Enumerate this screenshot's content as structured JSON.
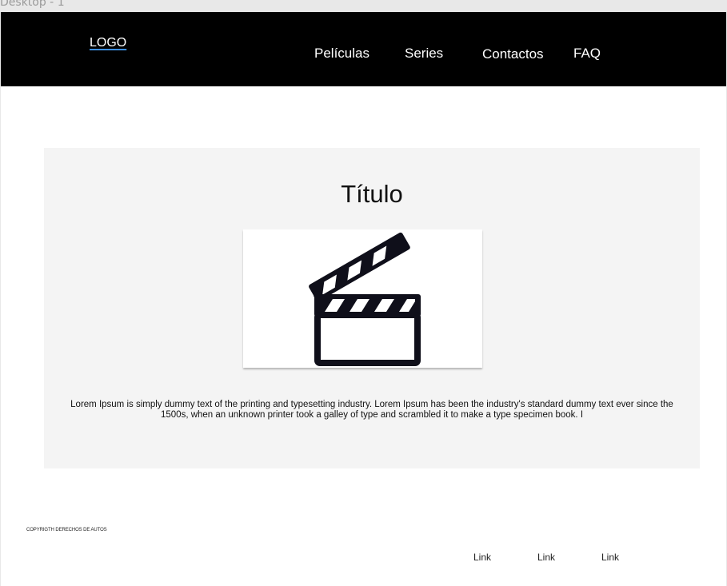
{
  "frame": {
    "label": "Desktop - 1"
  },
  "header": {
    "logo": "LOGO",
    "nav": [
      "Películas",
      "Series",
      "Contactos",
      "FAQ"
    ]
  },
  "hero": {
    "title": "Título",
    "image_icon": "clapperboard-icon",
    "text": "Lorem Ipsum is simply dummy text of the printing and typesetting industry. Lorem Ipsum has been the industry's standard dummy text ever since the 1500s, when an unknown printer took a galley of type and scrambled it to make a type specimen book. I"
  },
  "footer": {
    "copyright": "COPYRIGTH DERECHOS DE AUTOS",
    "links": [
      "Link",
      "Link",
      "Link"
    ]
  },
  "colors": {
    "navbar_bg": "#000000",
    "hero_bg": "#f4f4f4",
    "logo_underline": "#3d8fe0"
  }
}
